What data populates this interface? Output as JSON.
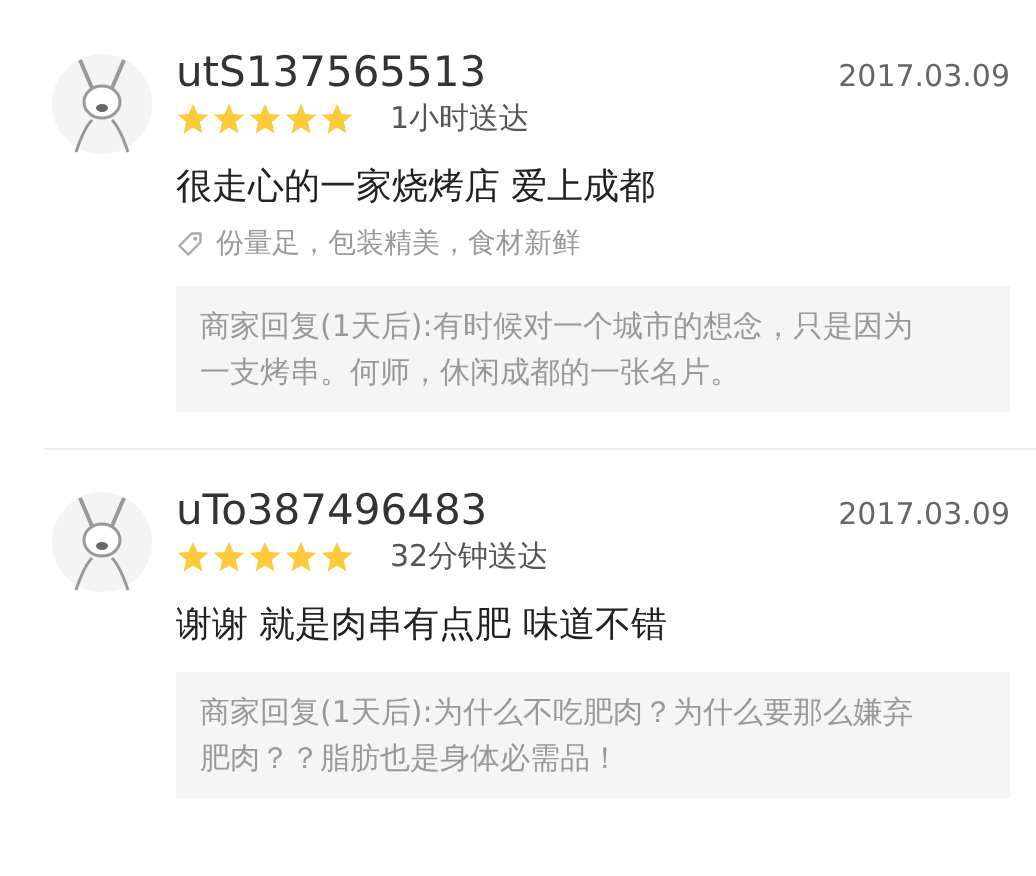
{
  "reviews": [
    {
      "username": "utS137565513",
      "date": "2017.03.09",
      "stars": 5,
      "delivery": "1小时送达",
      "comment": "很走心的一家烧烤店 爱上成都",
      "tags": "份量足，包装精美，食材新鲜",
      "reply": "商家回复(1天后):有时候对一个城市的想念，只是因为一支烤串。何师，休闲成都的一张名片。"
    },
    {
      "username": "uTo387496483",
      "date": "2017.03.09",
      "stars": 5,
      "delivery": "32分钟送达",
      "comment": "谢谢 就是肉串有点肥 味道不错",
      "reply": "商家回复(1天后):为什么不吃肥肉？为什么要那么嫌弃肥肉？？脂肪也是身体必需品！"
    }
  ]
}
